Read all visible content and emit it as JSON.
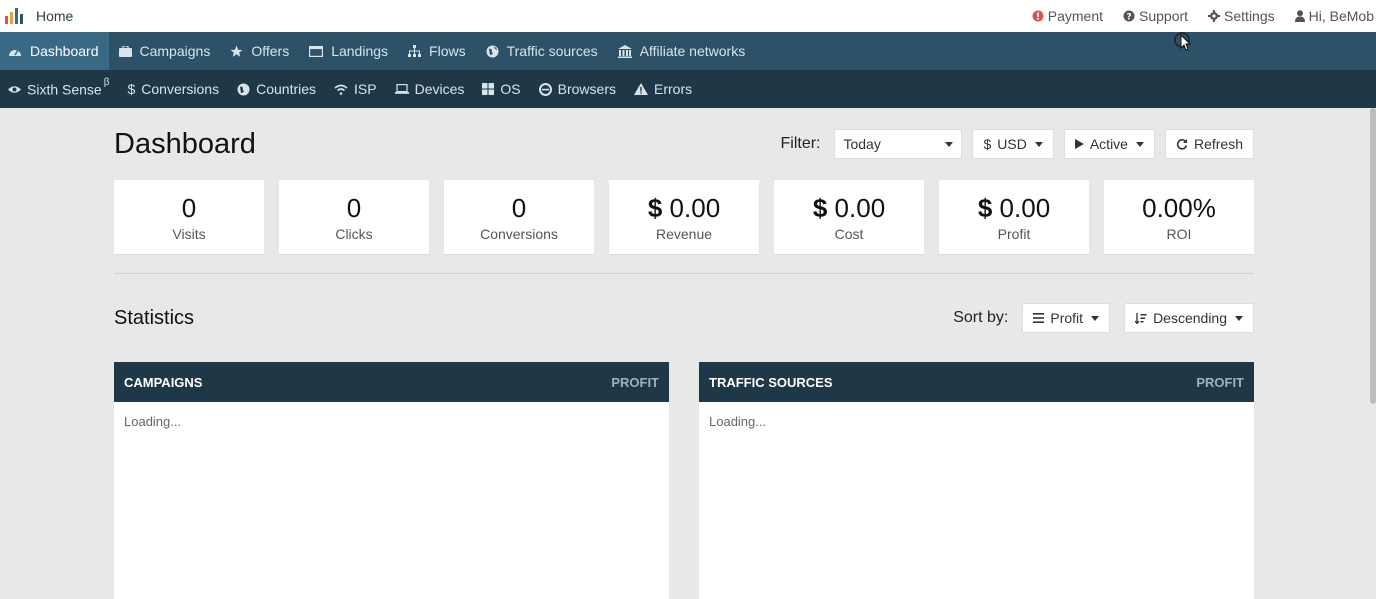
{
  "topbar": {
    "home": "Home",
    "links": [
      {
        "label": "Payment",
        "icon": "alert-icon"
      },
      {
        "label": "Support",
        "icon": "question-icon"
      },
      {
        "label": "Settings",
        "icon": "gear-icon"
      },
      {
        "label": "Hi, BeMob",
        "icon": "user-icon"
      }
    ]
  },
  "nav_primary": [
    {
      "label": "Dashboard",
      "icon": "dashboard-icon",
      "active": true
    },
    {
      "label": "Campaigns",
      "icon": "briefcase-icon"
    },
    {
      "label": "Offers",
      "icon": "star-icon"
    },
    {
      "label": "Landings",
      "icon": "window-icon"
    },
    {
      "label": "Flows",
      "icon": "sitemap-icon"
    },
    {
      "label": "Traffic sources",
      "icon": "globe-icon"
    },
    {
      "label": "Affiliate networks",
      "icon": "bank-icon"
    }
  ],
  "nav_secondary": [
    {
      "label": "Sixth Sense",
      "sup": "β",
      "icon": "eye-icon"
    },
    {
      "label": "Conversions",
      "icon": "dollar-icon"
    },
    {
      "label": "Countries",
      "icon": "globe-icon"
    },
    {
      "label": "ISP",
      "icon": "wifi-icon"
    },
    {
      "label": "Devices",
      "icon": "laptop-icon"
    },
    {
      "label": "OS",
      "icon": "windows-icon"
    },
    {
      "label": "Browsers",
      "icon": "browser-icon"
    },
    {
      "label": "Errors",
      "icon": "warning-icon"
    }
  ],
  "page": {
    "title": "Dashboard",
    "filter_label": "Filter:",
    "filter_value": "Today",
    "currency_symbol": "$",
    "currency": "USD",
    "status": "Active",
    "refresh": "Refresh"
  },
  "stats": [
    {
      "value": "0",
      "label": "Visits"
    },
    {
      "value": "0",
      "label": "Clicks"
    },
    {
      "value": "0",
      "label": "Conversions"
    },
    {
      "prefix": "$",
      "value": "0.00",
      "label": "Revenue"
    },
    {
      "prefix": "$",
      "value": "0.00",
      "label": "Cost"
    },
    {
      "prefix": "$",
      "value": "0.00",
      "label": "Profit"
    },
    {
      "value": "0.00%",
      "label": "ROI"
    }
  ],
  "statistics": {
    "title": "Statistics",
    "sort_label": "Sort by:",
    "sort_field": "Profit",
    "sort_order": "Descending",
    "panels": [
      {
        "title": "CAMPAIGNS",
        "column": "PROFIT",
        "body": "Loading..."
      },
      {
        "title": "TRAFFIC SOURCES",
        "column": "PROFIT",
        "body": "Loading..."
      }
    ]
  },
  "colors": {
    "nav_primary": "#2d5167",
    "nav_active": "#3a6985",
    "nav_secondary": "#1f3847",
    "background": "#e8e8e8",
    "alert": "#d9534f"
  }
}
